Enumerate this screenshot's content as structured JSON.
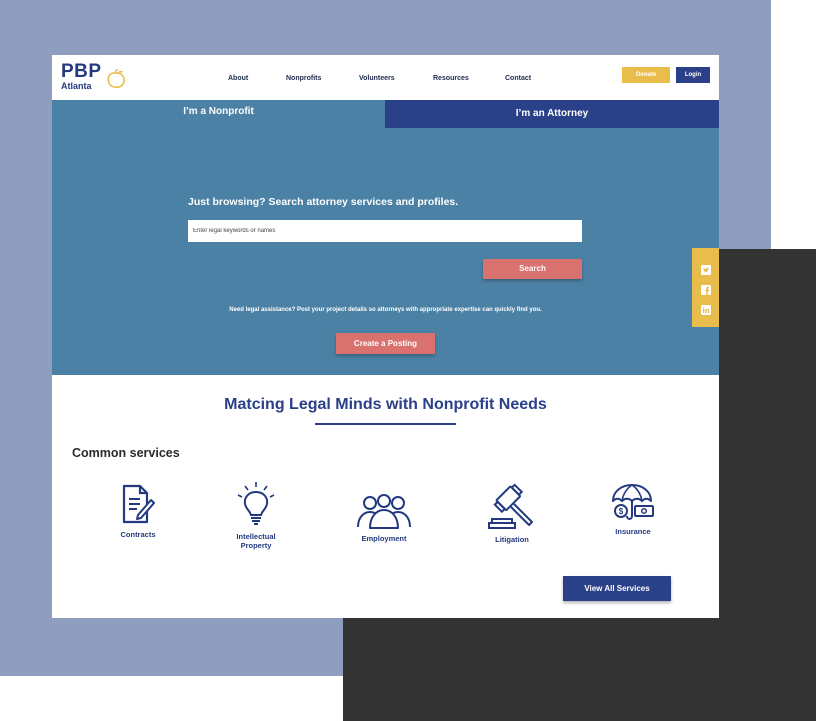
{
  "colors": {
    "backdrop_lavender": "#8f9dbe",
    "backdrop_dark": "#333333",
    "navy": "#2a4089",
    "hero_blue": "#4b81a5",
    "coral": "#d9726f",
    "donate_gold": "#e8bd4c",
    "logo_navy": "#243a80",
    "icon_navy": "#243a80"
  },
  "nav": {
    "logo_text": "PBP",
    "logo_subtext": "Atlanta",
    "links": [
      "About",
      "Nonprofits",
      "Volunteers",
      "Resources",
      "Contact"
    ],
    "donate_label": "Donate",
    "login_label": "Login"
  },
  "tabs": {
    "nonprofit_label": "I’m a Nonprofit",
    "attorney_label": "I’m an Attorney"
  },
  "hero": {
    "heading": "Just browsing? Search attorney services and profiles.",
    "search_placeholder": "Enter legal keywords or names",
    "search_value": "",
    "search_button_label": "Search",
    "note": "Need legal assistance? Post your project details so attorneys with appropriate expertise can quickly find you.",
    "posting_button_label": "Create a Posting"
  },
  "social": {
    "icons": [
      "twitter-icon",
      "facebook-icon",
      "linkedin-icon"
    ]
  },
  "main": {
    "title": "Matcing Legal Minds with Nonprofit Needs",
    "services_heading": "Common services",
    "services": [
      {
        "label": "Contracts",
        "icon": "contract-document-icon"
      },
      {
        "label": "Intellectual Property",
        "icon": "lightbulb-icon"
      },
      {
        "label": "Employment",
        "icon": "people-group-icon"
      },
      {
        "label": "Litigation",
        "icon": "gavel-icon"
      },
      {
        "label": "Insurance",
        "icon": "umbrella-money-icon"
      }
    ],
    "view_all_label": "View All Services"
  }
}
